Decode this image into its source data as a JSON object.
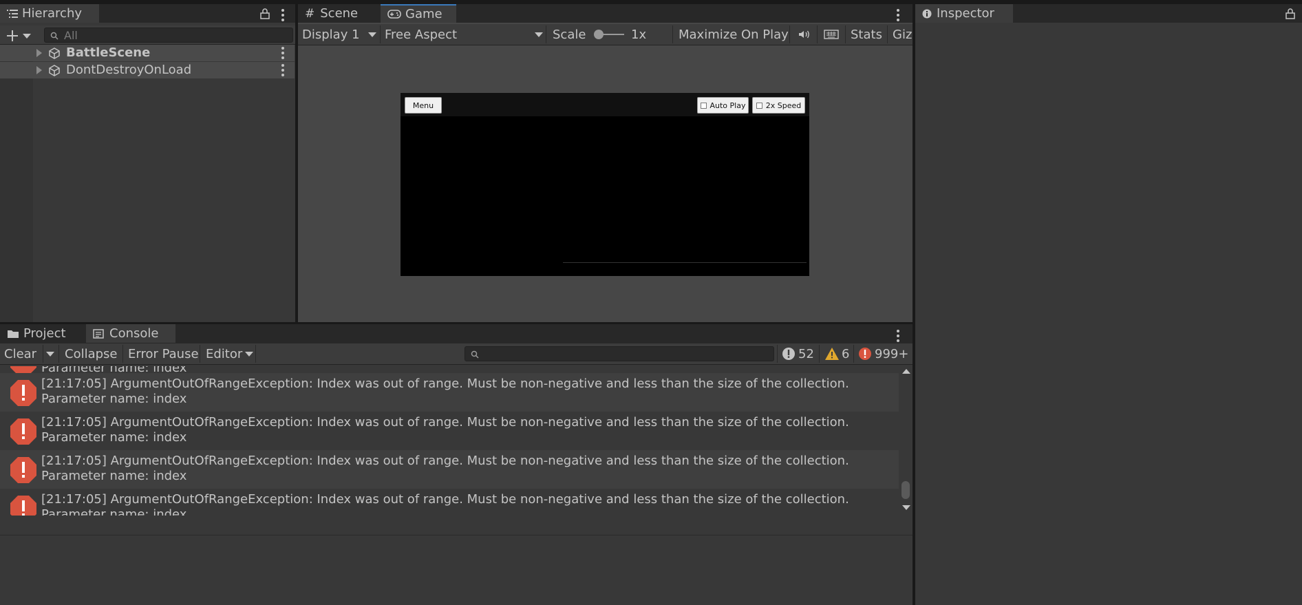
{
  "hierarchy": {
    "tab_label": "Hierarchy",
    "search_placeholder": "All",
    "items": [
      {
        "label": "BattleScene"
      },
      {
        "label": "DontDestroyOnLoad"
      }
    ]
  },
  "center": {
    "tabs": [
      {
        "label": "Scene"
      },
      {
        "label": "Game"
      }
    ],
    "toolbar": {
      "display": "Display 1",
      "aspect": "Free Aspect",
      "scale_label": "Scale",
      "scale_value": "1x",
      "maximize": "Maximize On Play",
      "stats": "Stats",
      "gizmos": "Gizmos"
    },
    "game_view": {
      "menu_button": "Menu",
      "auto_play": "Auto Play",
      "speed": "2x Speed"
    }
  },
  "inspector": {
    "tab_label": "Inspector"
  },
  "bottom": {
    "tabs": [
      {
        "label": "Project"
      },
      {
        "label": "Console"
      }
    ],
    "toolbar": {
      "clear": "Clear",
      "collapse": "Collapse",
      "error_pause": "Error Pause",
      "editor": "Editor",
      "log_count": "52",
      "warning_count": "6",
      "error_count": "999+"
    },
    "partial_line": "Parameter name: index",
    "logs": [
      {
        "line1": "[21:17:05] ArgumentOutOfRangeException: Index was out of range. Must be non-negative and less than the size of the collection.",
        "line2": "Parameter name: index"
      },
      {
        "line1": "[21:17:05] ArgumentOutOfRangeException: Index was out of range. Must be non-negative and less than the size of the collection.",
        "line2": "Parameter name: index"
      },
      {
        "line1": "[21:17:05] ArgumentOutOfRangeException: Index was out of range. Must be non-negative and less than the size of the collection.",
        "line2": "Parameter name: index"
      },
      {
        "line1": "[21:17:05] ArgumentOutOfRangeException: Index was out of range. Must be non-negative and less than the size of the collection.",
        "line2": "Parameter name: index"
      }
    ]
  },
  "colors": {
    "error": "#d9543f",
    "warning": "#e0a82e",
    "accent": "#3a79bb"
  }
}
